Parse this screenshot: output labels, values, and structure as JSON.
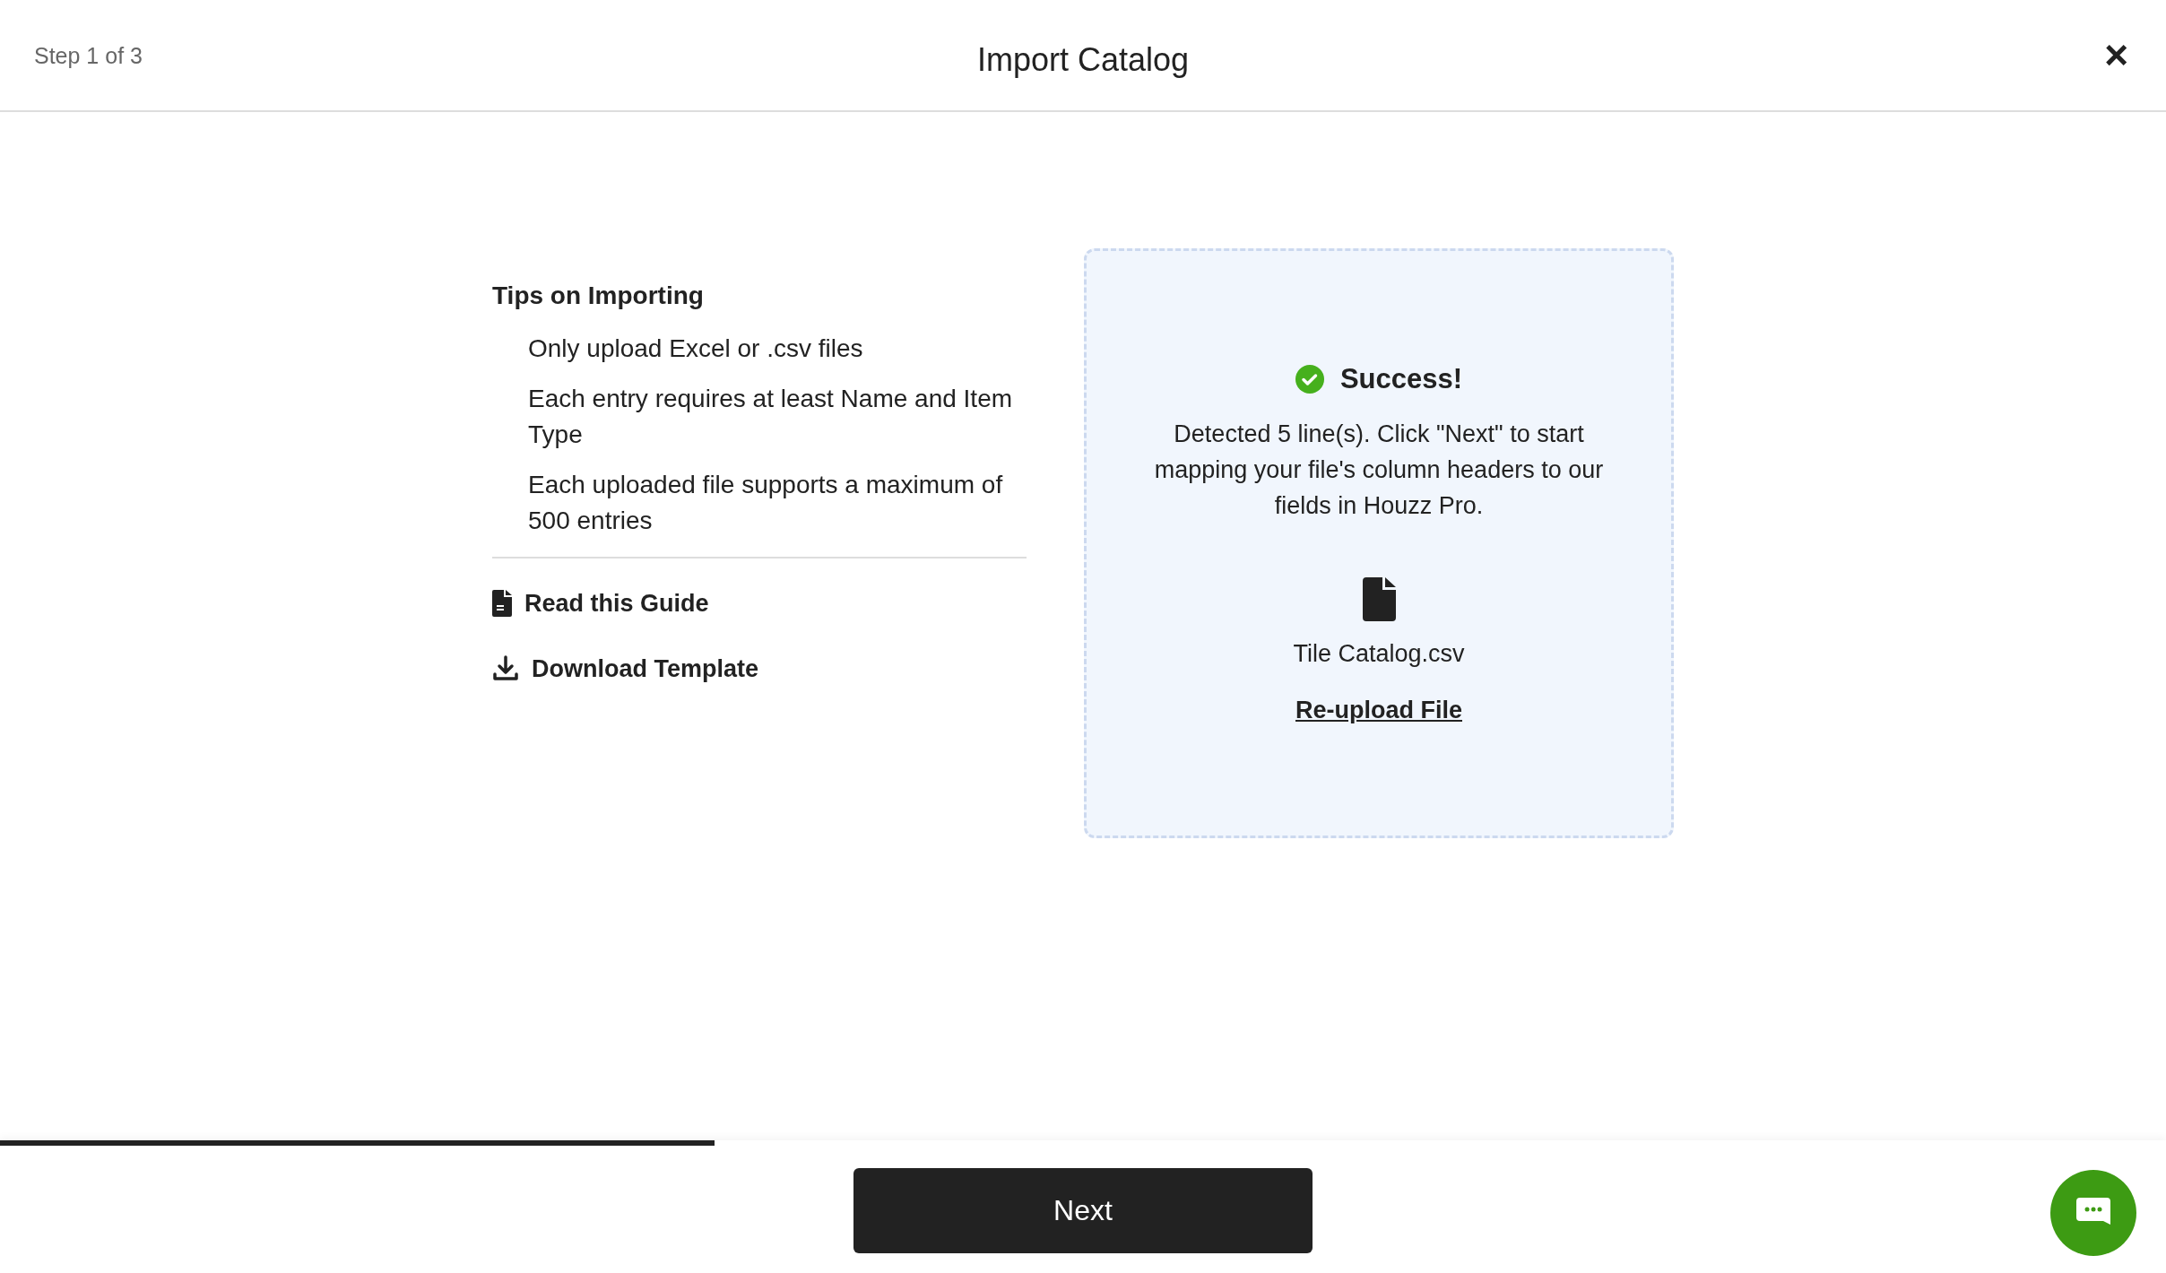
{
  "header": {
    "step": "Step 1 of 3",
    "title": "Import Catalog",
    "close": "×"
  },
  "tips": {
    "title": "Tips on Importing",
    "items": [
      "Only upload Excel or .csv files",
      "Each entry requires at least Name and Item Type",
      "Each uploaded file supports a maximum of 500 entries"
    ],
    "links": [
      {
        "kind": "guide",
        "label": "Read this Guide"
      },
      {
        "kind": "download",
        "label": "Download Template"
      }
    ]
  },
  "upload": {
    "status": "Success!",
    "message": "Detected 5 line(s). Click \"Next\" to start mapping your file's column headers to our fields in Houzz Pro.",
    "file_name": "Tile Catalog.csv",
    "reupload": "Re-upload File"
  },
  "progress": {
    "level": 0.33
  },
  "footer": {
    "next": "Next"
  }
}
